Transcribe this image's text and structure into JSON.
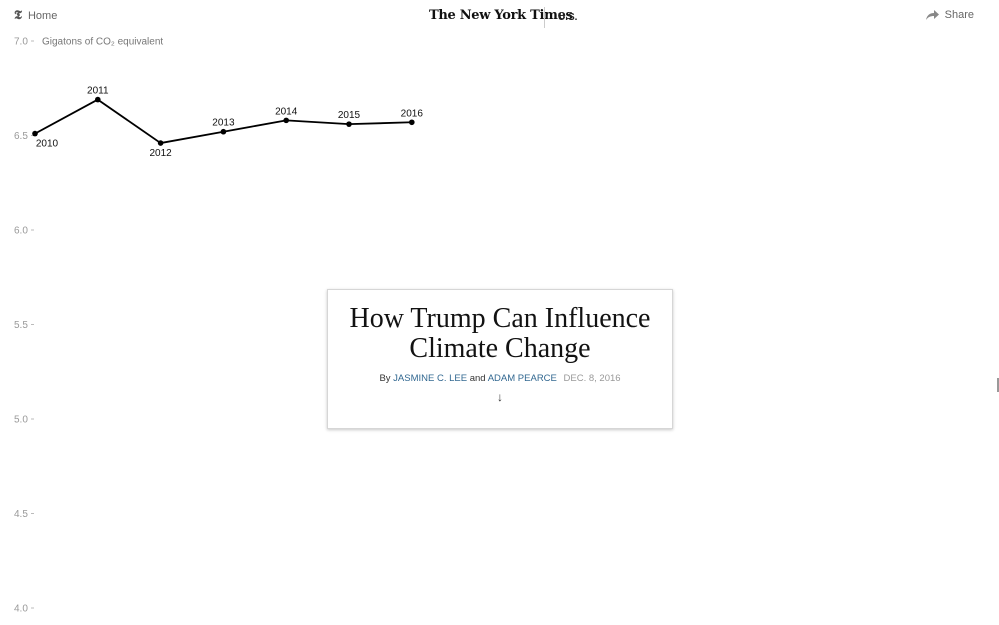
{
  "header": {
    "home_label": "Home",
    "home_icon": "nyt-t-logo-icon",
    "masthead": "The New York Times",
    "section": "U.S.",
    "share_label": "Share",
    "share_icon": "share-arrow-icon"
  },
  "article": {
    "headline": "How Trump Can Influence Climate Change",
    "byline_prefix": "By",
    "author1": "JASMINE C. LEE",
    "byline_and": "and",
    "author2": "ADAM PEARCE",
    "date": "DEC. 8, 2016",
    "scroll_arrow": "↓"
  },
  "chart_data": {
    "type": "line",
    "ylabel": "Gigatons of CO₂ equivalent",
    "ylim": [
      4.0,
      7.0
    ],
    "yticks": [
      "7.0",
      "6.5",
      "6.0",
      "5.5",
      "5.0",
      "4.5",
      "4.0"
    ],
    "x": [
      "2010",
      "2011",
      "2012",
      "2013",
      "2014",
      "2015",
      "2016"
    ],
    "values": [
      6.51,
      6.69,
      6.46,
      6.52,
      6.58,
      6.56,
      6.57
    ],
    "label_positions": [
      "below",
      "above",
      "below",
      "above",
      "above",
      "above",
      "above"
    ],
    "grid": false,
    "color": "#000000"
  }
}
